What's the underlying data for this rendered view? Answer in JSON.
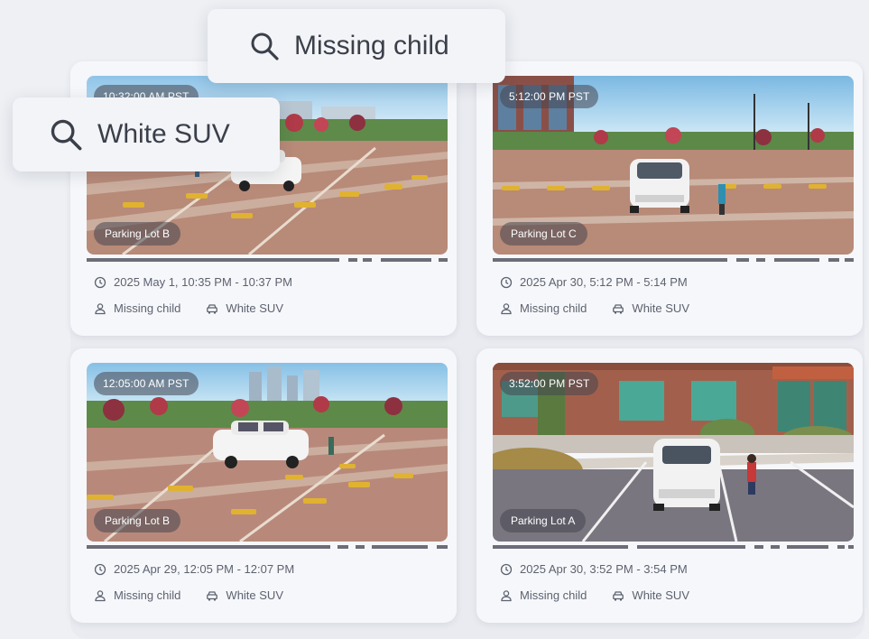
{
  "searches": [
    {
      "query": "Missing child"
    },
    {
      "query": "White SUV"
    }
  ],
  "cards": [
    {
      "timestamp": "10:32:00 AM PST",
      "location": "Parking Lot B",
      "time_range": "2025 May 1, 10:35 PM - 10:37 PM",
      "tags": [
        "Missing child",
        "White SUV"
      ]
    },
    {
      "timestamp": "5:12:00 PM PST",
      "location": "Parking Lot C",
      "time_range": "2025 Apr 30, 5:12 PM - 5:14 PM",
      "tags": [
        "Missing child",
        "White SUV"
      ]
    },
    {
      "timestamp": "12:05:00 AM PST",
      "location": "Parking Lot B",
      "time_range": "2025 Apr 29, 12:05 PM - 12:07 PM",
      "tags": [
        "Missing child",
        "White SUV"
      ]
    },
    {
      "timestamp": "3:52:00 PM PST",
      "location": "Parking Lot A",
      "time_range": "2025 Apr 30, 3:52 PM - 3:54 PM",
      "tags": [
        "Missing child",
        "White SUV"
      ]
    }
  ],
  "icons": {
    "search": "search-icon",
    "clock": "clock-icon",
    "person": "person-icon",
    "car": "car-icon"
  },
  "colors": {
    "background": "#eef0f4",
    "card": "#f6f7fa",
    "text": "#5d6270",
    "badge": "#464650"
  }
}
